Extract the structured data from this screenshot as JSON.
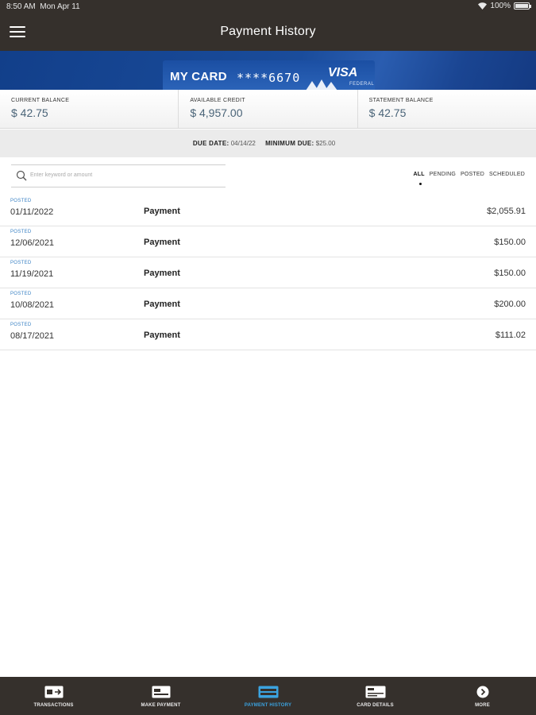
{
  "status_bar": {
    "time": "8:50 AM",
    "date": "Mon Apr 11",
    "battery": "100%"
  },
  "header": {
    "title": "Payment History"
  },
  "card": {
    "name": "MY CARD",
    "masked_number": "****6670",
    "brand": "VISA",
    "brand_sub": "FEDERAL"
  },
  "balances": [
    {
      "label": "CURRENT BALANCE",
      "value": "$ 42.75"
    },
    {
      "label": "AVAILABLE CREDIT",
      "value": "$ 4,957.00"
    },
    {
      "label": "STATEMENT BALANCE",
      "value": "$ 42.75"
    }
  ],
  "due": {
    "due_date_label": "DUE DATE:",
    "due_date": "04/14/22",
    "min_due_label": "MINIMUM DUE:",
    "min_due": "$25.00"
  },
  "search": {
    "placeholder": "Enter keyword or amount"
  },
  "filters": [
    {
      "label": "ALL",
      "active": true
    },
    {
      "label": "PENDING",
      "active": false
    },
    {
      "label": "POSTED",
      "active": false
    },
    {
      "label": "SCHEDULED",
      "active": false
    }
  ],
  "payments": [
    {
      "status": "POSTED",
      "date": "01/11/2022",
      "description": "Payment",
      "amount": "$2,055.91"
    },
    {
      "status": "POSTED",
      "date": "12/06/2021",
      "description": "Payment",
      "amount": "$150.00"
    },
    {
      "status": "POSTED",
      "date": "11/19/2021",
      "description": "Payment",
      "amount": "$150.00"
    },
    {
      "status": "POSTED",
      "date": "10/08/2021",
      "description": "Payment",
      "amount": "$200.00"
    },
    {
      "status": "POSTED",
      "date": "08/17/2021",
      "description": "Payment",
      "amount": "$111.02"
    }
  ],
  "bottom_nav": [
    {
      "label": "TRANSACTIONS",
      "icon": "transactions-icon",
      "active": false
    },
    {
      "label": "MAKE PAYMENT",
      "icon": "make-payment-icon",
      "active": false
    },
    {
      "label": "PAYMENT HISTORY",
      "icon": "payment-history-icon",
      "active": true
    },
    {
      "label": "CARD DETAILS",
      "icon": "card-details-icon",
      "active": false
    },
    {
      "label": "MORE",
      "icon": "more-icon",
      "active": false
    }
  ],
  "colors": {
    "header_bg": "#35302c",
    "accent": "#3ba3e0",
    "banner": "#1a4c9b",
    "balance_value": "#4a6478"
  }
}
